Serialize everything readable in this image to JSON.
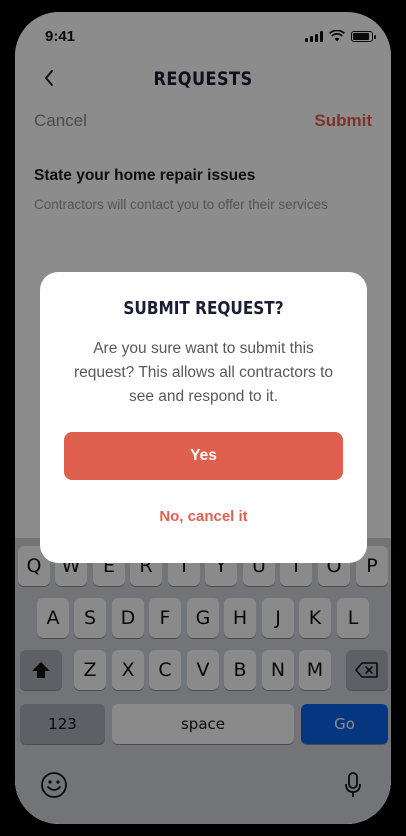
{
  "status_bar": {
    "time": "9:41"
  },
  "header": {
    "title": "REQUESTS",
    "back_icon": "chevron-left-icon"
  },
  "actions": {
    "cancel_label": "Cancel",
    "submit_label": "Submit"
  },
  "form": {
    "section_title": "State your home repair issues",
    "section_subtitle": "Contractors will contact you to offer their services"
  },
  "dialog": {
    "title": "SUBMIT REQUEST?",
    "message": "Are you sure want to submit this request? This allows all contractors to see and respond to it.",
    "confirm_label": "Yes",
    "cancel_label": "No, cancel it"
  },
  "keyboard": {
    "row1": [
      "Q",
      "W",
      "E",
      "R",
      "T",
      "Y",
      "U",
      "I",
      "O",
      "P"
    ],
    "row2": [
      "A",
      "S",
      "D",
      "F",
      "G",
      "H",
      "J",
      "K",
      "L"
    ],
    "row3": [
      "Z",
      "X",
      "C",
      "V",
      "B",
      "N",
      "M"
    ],
    "numbers_label": "123",
    "space_label": "space",
    "go_label": "Go"
  },
  "colors": {
    "accent": "#e0604f",
    "title": "#1b1e33",
    "go_key": "#0c63e7"
  }
}
